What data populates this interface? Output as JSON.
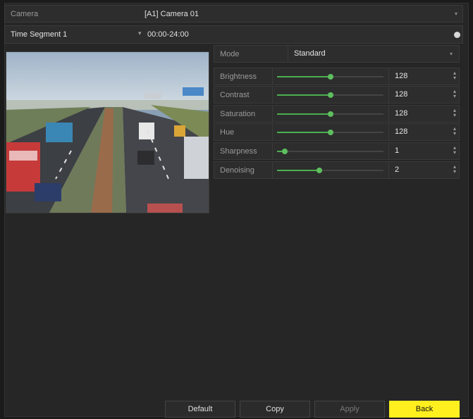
{
  "camera": {
    "label": "Camera",
    "value": "[A1] Camera 01"
  },
  "segment": {
    "label": "Time Segment 1",
    "value": "00:00-24:00"
  },
  "preview": {},
  "mode": {
    "label": "Mode",
    "value": "Standard"
  },
  "params": [
    {
      "label": "Brightness",
      "value": "128",
      "level": 0.5
    },
    {
      "label": "Contrast",
      "value": "128",
      "level": 0.5
    },
    {
      "label": "Saturation",
      "value": "128",
      "level": 0.5
    },
    {
      "label": "Hue",
      "value": "128",
      "level": 0.5
    },
    {
      "label": "Sharpness",
      "value": "1",
      "level": 0.07
    },
    {
      "label": "Denoising",
      "value": "2",
      "level": 0.4
    }
  ],
  "buttons": {
    "default": "Default",
    "copy": "Copy",
    "apply": "Apply",
    "back": "Back"
  },
  "colors": {
    "accent": "#4caf50",
    "back_button": "#ffef1f"
  }
}
